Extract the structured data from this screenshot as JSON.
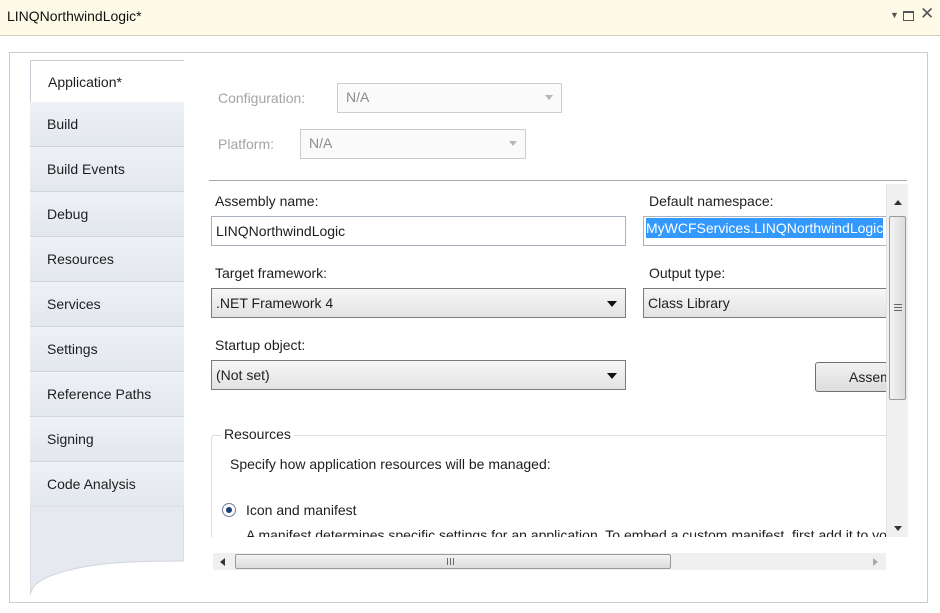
{
  "window": {
    "title": "LINQNorthwindLogic*",
    "controls": {
      "menu": "▼",
      "close": "✕"
    }
  },
  "tabs": [
    {
      "label": "Application*",
      "active": true
    },
    {
      "label": "Build",
      "active": false
    },
    {
      "label": "Build Events",
      "active": false
    },
    {
      "label": "Debug",
      "active": false
    },
    {
      "label": "Resources",
      "active": false
    },
    {
      "label": "Services",
      "active": false
    },
    {
      "label": "Settings",
      "active": false
    },
    {
      "label": "Reference Paths",
      "active": false
    },
    {
      "label": "Signing",
      "active": false
    },
    {
      "label": "Code Analysis",
      "active": false
    }
  ],
  "config": {
    "configuration_label": "Configuration:",
    "configuration_value": "N/A",
    "platform_label": "Platform:",
    "platform_value": "N/A"
  },
  "form": {
    "assembly_name_label": "Assembly name:",
    "assembly_name_value": "LINQNorthwindLogic",
    "default_namespace_label": "Default namespace:",
    "default_namespace_value": "MyWCFServices.LINQNorthwindLogic",
    "target_framework_label": "Target framework:",
    "target_framework_value": ".NET Framework 4",
    "output_type_label": "Output type:",
    "output_type_value": "Class Library",
    "startup_object_label": "Startup object:",
    "startup_object_value": "(Not set)",
    "assembly_info_button": "Assembly Information..."
  },
  "resources": {
    "group_title": "Resources",
    "description": "Specify how application resources will be managed:",
    "option_icon_manifest": "Icon and manifest",
    "manifest_text": "A manifest determines specific settings for an application. To embed a custom manifest, first add it to your project and then select it from the list below.",
    "option_selected": "Icon and manifest"
  },
  "scrollbars": {
    "vertical_position": 0.0,
    "horizontal_position": 0.0
  },
  "colors": {
    "titlebar_bg": "#fdfbe7",
    "selection_bg": "#3399ff",
    "tab_bg": "#e6e9ef"
  }
}
